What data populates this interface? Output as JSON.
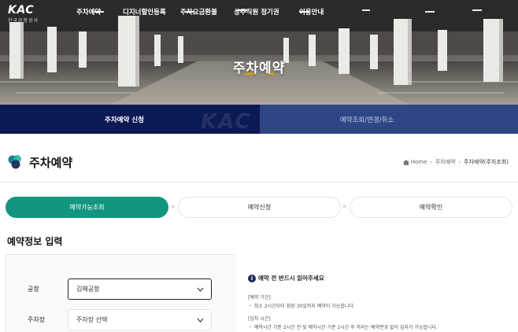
{
  "header": {
    "logo_mark": "KAC",
    "logo_sub": "한국공항공사",
    "nav": [
      "주차예약",
      "디지너할인등록",
      "주차요금환불",
      "상주직원 정기권",
      "이용안내"
    ]
  },
  "hero": {
    "title": "주차예약"
  },
  "tabs": [
    {
      "label": "주차예약 신청",
      "active": true
    },
    {
      "label": "예약조회/변경/취소",
      "active": false
    }
  ],
  "page": {
    "title": "주차예약",
    "breadcrumb": [
      "Home",
      "주차예약",
      "주차예약(주차조회)"
    ]
  },
  "steps": [
    "예약가능조회",
    "예약신청",
    "예약확인"
  ],
  "form": {
    "section_title": "예약정보 입력",
    "airport_label": "공항",
    "airport_value": "김해공항",
    "lot_label": "주차장",
    "lot_placeholder": "주차장 선택"
  },
  "notice": {
    "title": "예약 전 반드시 읽어주세요",
    "items": [
      "[예약 기간]",
      "・ 최소 2시간부터 최장 30일까지 예약이 가능합니다.",
      "[입차 시간]",
      "・ 예약시간 기준 2시간 전 및 예약시간 기준 2시간 후 까지는 예약변경 없이 입차가 가능합니다."
    ]
  },
  "colors": {
    "tab_active": "#0b1a55",
    "tab_inactive": "#2e4686",
    "step_active": "#12967f"
  }
}
